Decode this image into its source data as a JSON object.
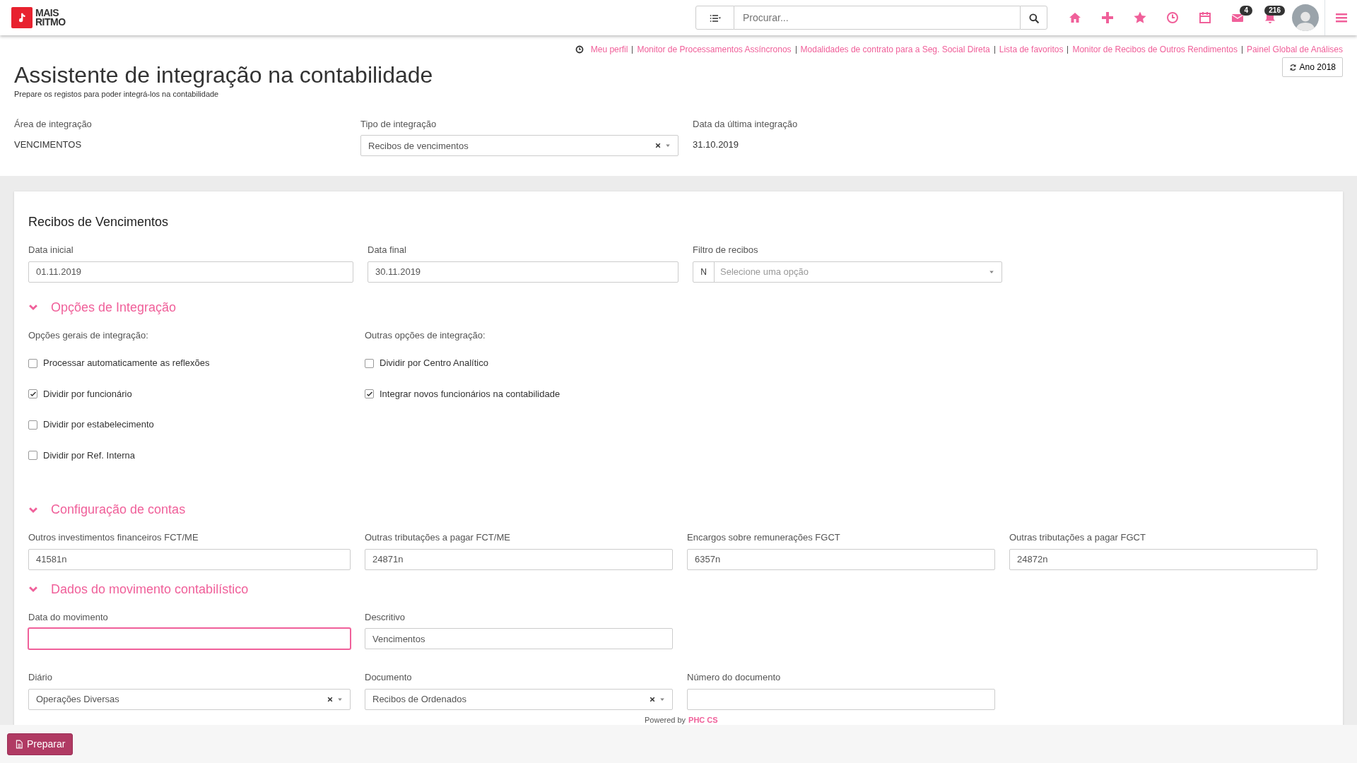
{
  "topbar": {
    "logo": [
      "MAIS",
      "RITMO"
    ],
    "search": {
      "placeholder": "Procurar..."
    },
    "tools": [
      {
        "kind": "home"
      },
      {
        "kind": "plus"
      },
      {
        "kind": "star"
      },
      {
        "kind": "clock"
      },
      {
        "kind": "calendar"
      },
      {
        "kind": "mail",
        "badge": "4"
      },
      {
        "kind": "bell",
        "badge": "216"
      }
    ]
  },
  "links": [
    "Meu perfil",
    "Monitor de Processamentos Assíncronos",
    "Modalidades de contrato para a Seg. Social Direta",
    "Lista de favoritos",
    "Monitor de Recibos de Outros Rendimentos",
    "Painel Global de Análises"
  ],
  "year_button": "Ano 2018",
  "page": {
    "title": "Assistente de integração na contabilidade",
    "subtitle": "Prepare os registos para poder integrá-los na contabilidade"
  },
  "header_fields": [
    {
      "kind": "text",
      "label": "Área de integração",
      "value": "VENCIMENTOS"
    },
    {
      "kind": "select",
      "label": "Tipo de integração",
      "value": "Recibos de vencimentos"
    },
    {
      "kind": "text",
      "label": "Data da última integração",
      "value": "31.10.2019"
    }
  ],
  "card": {
    "title": "Recibos de Vencimentos",
    "fields": [
      {
        "kind": "input",
        "label": "Data inicial",
        "value": "01.11.2019"
      },
      {
        "kind": "input",
        "label": "Data final",
        "value": "30.11.2019"
      },
      {
        "kind": "filter",
        "label": "Filtro de recibos",
        "prefix": "N",
        "placeholder": "Selecione uma opção"
      }
    ],
    "sections": [
      {
        "kind": "options",
        "title": "Opções de Integração",
        "expanded": true,
        "groups": [
          {
            "heading": "Opções gerais de integração:",
            "options": [
              {
                "label": "Processar automaticamente as reflexões",
                "checked": false
              },
              {
                "label": "Dividir por funcionário",
                "checked": true
              },
              {
                "label": "Dividir por estabelecimento",
                "checked": false
              },
              {
                "label": "Dividir por Ref. Interna",
                "checked": false
              }
            ]
          },
          {
            "heading": "Outras opções de integração:",
            "options": [
              {
                "label": "Dividir por Centro Analítico",
                "checked": false
              },
              {
                "label": "Integrar novos funcionários na contabilidade",
                "checked": true
              }
            ]
          }
        ]
      },
      {
        "kind": "fields",
        "title": "Configuração de contas",
        "expanded": true,
        "rows": [
          [
            {
              "kind": "input",
              "label": "Outros investimentos financeiros FCT/ME",
              "value": "41581n"
            },
            {
              "kind": "input",
              "label": "Outras tributações a pagar FCT/ME",
              "value": "24871n"
            },
            {
              "kind": "input",
              "label": "Encargos sobre remunerações FGCT",
              "value": "6357n"
            },
            {
              "kind": "input",
              "label": "Outras tributações a pagar FGCT",
              "value": "24872n"
            }
          ]
        ]
      },
      {
        "kind": "fields",
        "title": "Dados do movimento contabilístico",
        "expanded": true,
        "rows": [
          [
            {
              "kind": "input",
              "label": "Data do movimento",
              "focused": true
            },
            {
              "kind": "input",
              "label": "Descritivo",
              "value": "Vencimentos"
            }
          ],
          [
            {
              "kind": "select",
              "label": "Diário",
              "value": "Operações Diversas"
            },
            {
              "kind": "select",
              "label": "Documento",
              "value": "Recibos de Ordenados"
            },
            {
              "kind": "input",
              "label": "Número do documento"
            }
          ]
        ]
      }
    ]
  },
  "footer": {
    "powered_by": "Powered by",
    "brand": "PHC CS",
    "button": "Preparar"
  }
}
